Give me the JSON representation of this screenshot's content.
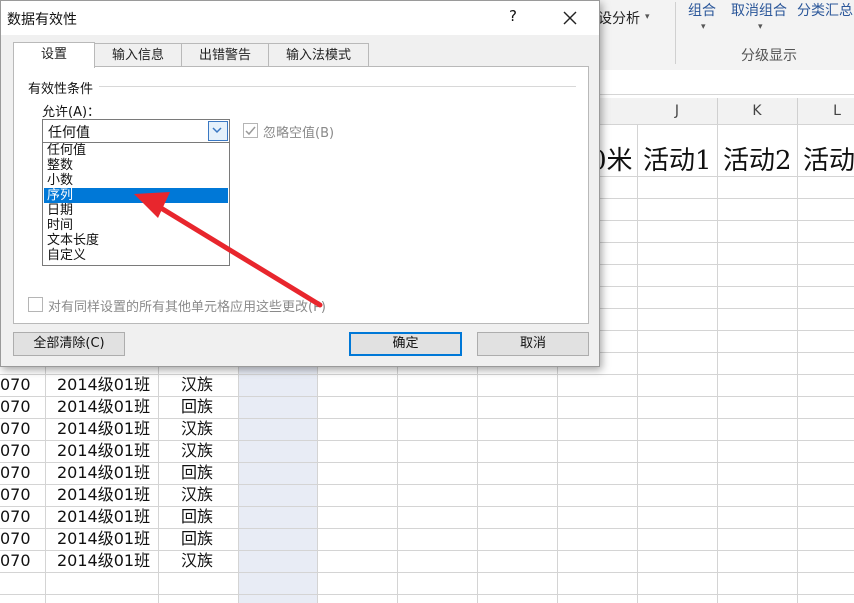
{
  "ribbon": {
    "analysis_label": "设分析",
    "group_label": "组合",
    "ungroup_label": "取消组合",
    "subtotal_label": "分类汇总",
    "outline_group_label": "分级显示"
  },
  "sheet": {
    "columns": [
      "J",
      "K",
      "L"
    ],
    "header_cells": [
      "0米",
      "活动1",
      "活动2",
      "活动"
    ],
    "rows": [
      {
        "id": "070",
        "class": "2014级01班",
        "nation": "汉族"
      },
      {
        "id": "070",
        "class": "2014级01班",
        "nation": "回族"
      },
      {
        "id": "070",
        "class": "2014级01班",
        "nation": "汉族"
      },
      {
        "id": "070",
        "class": "2014级01班",
        "nation": "汉族"
      },
      {
        "id": "070",
        "class": "2014级01班",
        "nation": "回族"
      },
      {
        "id": "070",
        "class": "2014级01班",
        "nation": "汉族"
      },
      {
        "id": "070",
        "class": "2014级01班",
        "nation": "回族"
      },
      {
        "id": "070",
        "class": "2014级01班",
        "nation": "回族"
      },
      {
        "id": "070",
        "class": "2014级01班",
        "nation": "汉族"
      }
    ]
  },
  "dialog": {
    "title": "数据有效性",
    "help": "?",
    "tabs": [
      "设置",
      "输入信息",
      "出错警告",
      "输入法模式"
    ],
    "active_tab": "设置",
    "criteria_group": "有效性条件",
    "allow_label": "允许(A)：",
    "allow_value": "任何值",
    "allow_options": [
      "任何值",
      "整数",
      "小数",
      "序列",
      "日期",
      "时间",
      "文本长度",
      "自定义"
    ],
    "highlighted_option": "序列",
    "ignore_blank": "忽略空值(B)",
    "apply_all": "对有同样设置的所有其他单元格应用这些更改(P)",
    "clear_all": "全部清除(C)",
    "ok": "确定",
    "cancel": "取消"
  },
  "colors": {
    "highlight": "#0078d7",
    "annotation_arrow": "#e8262d",
    "ribbon_text": "#2b579a"
  }
}
